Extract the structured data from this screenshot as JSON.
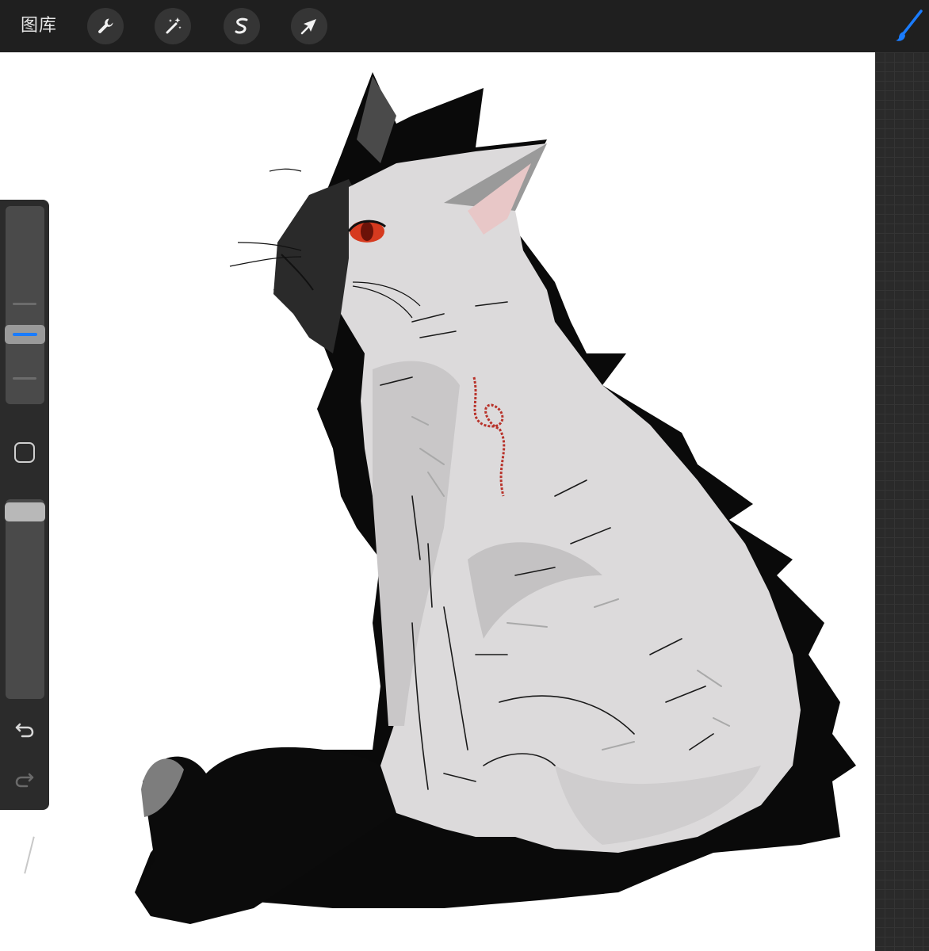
{
  "toolbar": {
    "gallery_label": "图库",
    "tools": [
      "wrench-icon",
      "magic-wand-icon",
      "selection-icon",
      "transform-arrow-icon"
    ],
    "brush_icon": "brush-icon",
    "accent_color": "#1a7cff"
  },
  "sidebar": {
    "size_slider_level": 0.66,
    "opacity_slider_level": 0.96,
    "modify_button_icon": "square-modify-icon",
    "undo_icon": "undo-icon",
    "redo_icon": "redo-icon"
  },
  "canvas": {
    "background": "#ffffff",
    "artwork": "sitting-cat-illustration"
  }
}
